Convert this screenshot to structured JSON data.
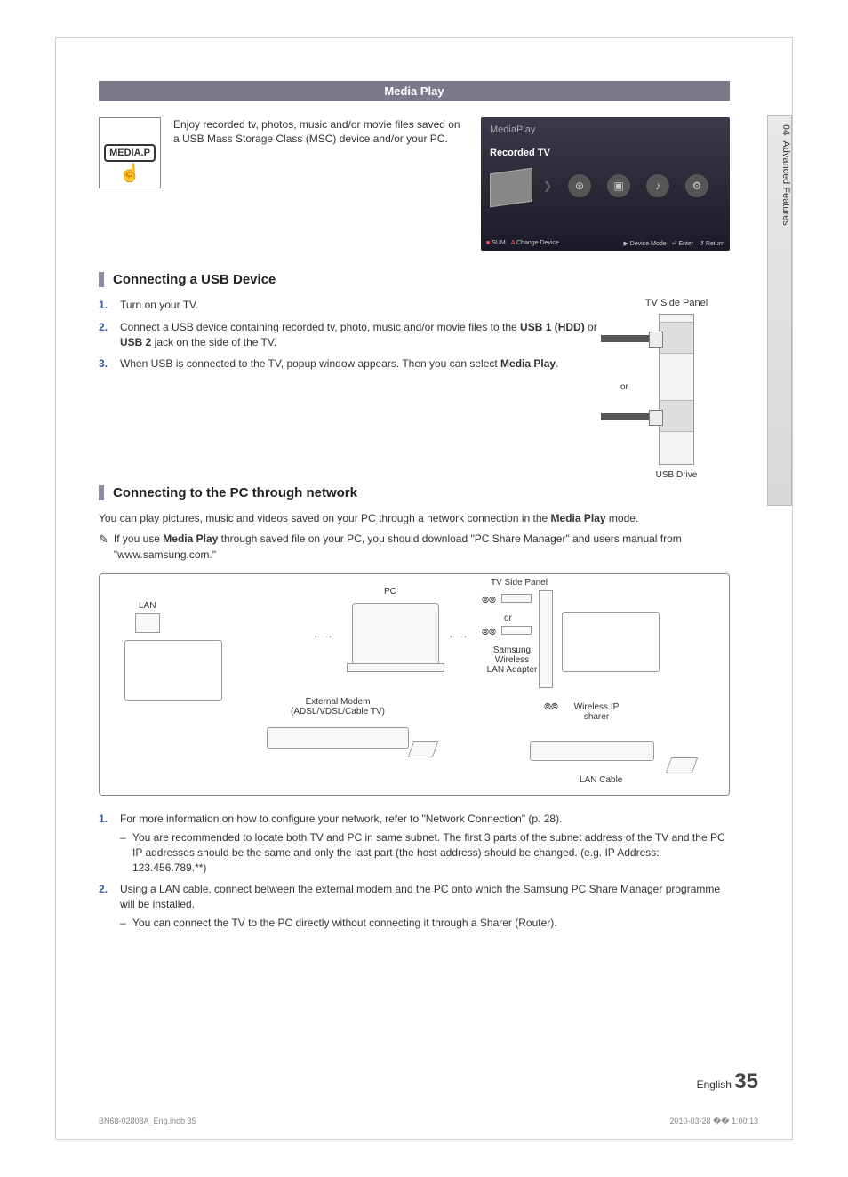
{
  "sideTab": {
    "num": "04",
    "title": "Advanced Features"
  },
  "banner": "Media Play",
  "mediaIcon": {
    "label": "MEDIA.P"
  },
  "introText": "Enjoy recorded tv, photos, music and/or movie files saved on a USB Mass Storage Class (MSC) device and/or your PC.",
  "tvShot": {
    "title": "MediaPlay",
    "subtitle": "Recorded TV",
    "footer": {
      "sum": "SUM",
      "change": "Change Device",
      "deviceMode": "Device Mode",
      "enter": "Enter",
      "ret": "Return"
    }
  },
  "usbSection": {
    "heading": "Connecting a USB Device",
    "steps": [
      {
        "text": "Turn on your TV."
      },
      {
        "html": "Connect a USB device containing recorded tv, photo, music and/or movie files to the <b>USB 1 (HDD)</b> or <b>USB 2</b> jack on the side of the TV."
      },
      {
        "html": "When USB is connected to the TV, popup window appears. Then you can select <b>Media Play</b>."
      }
    ],
    "panelLabel": "TV Side Panel",
    "orLabel": "or",
    "driveLabel": "USB Drive"
  },
  "pcSection": {
    "heading": "Connecting to the PC through network",
    "bodyHtml": "You can play pictures, music and videos saved on your PC through a network connection in the <b>Media Play</b> mode.",
    "noteHtml": "If you use <b>Media Play</b> through saved file on your PC, you should download \"PC Share Manager\" and users manual from \"www.samsung.com.\"",
    "diagram": {
      "lan": "LAN",
      "pc": "PC",
      "tvSidePanel": "TV Side Panel",
      "or": "or",
      "adapter": "Samsung Wireless LAN Adapter",
      "modem": "External Modem",
      "modemSub": "(ADSL/VDSL/Cable TV)",
      "sharer": "Wireless IP sharer",
      "lanCable": "LAN Cable"
    },
    "steps2": [
      {
        "text": "For more information on how to configure your network, refer to \"Network Connection\" (p. 28).",
        "sub": [
          "You are recommended to locate both TV and PC in same subnet. The first 3 parts of the subnet address of the TV and the PC IP addresses should be the same and only the last part (the host address) should be changed. (e.g. IP Address: 123.456.789.**)"
        ]
      },
      {
        "text": "Using a LAN cable, connect between the external modem and the PC onto which the Samsung PC Share Manager programme will be installed.",
        "sub": [
          "You can connect the TV to the PC directly without connecting it through a Sharer (Router)."
        ]
      }
    ]
  },
  "pageNum": {
    "lang": "English",
    "num": "35"
  },
  "footer": {
    "left": "BN68-02808A_Eng.indb   35",
    "right": "2010-03-28   �� 1:00:13"
  }
}
